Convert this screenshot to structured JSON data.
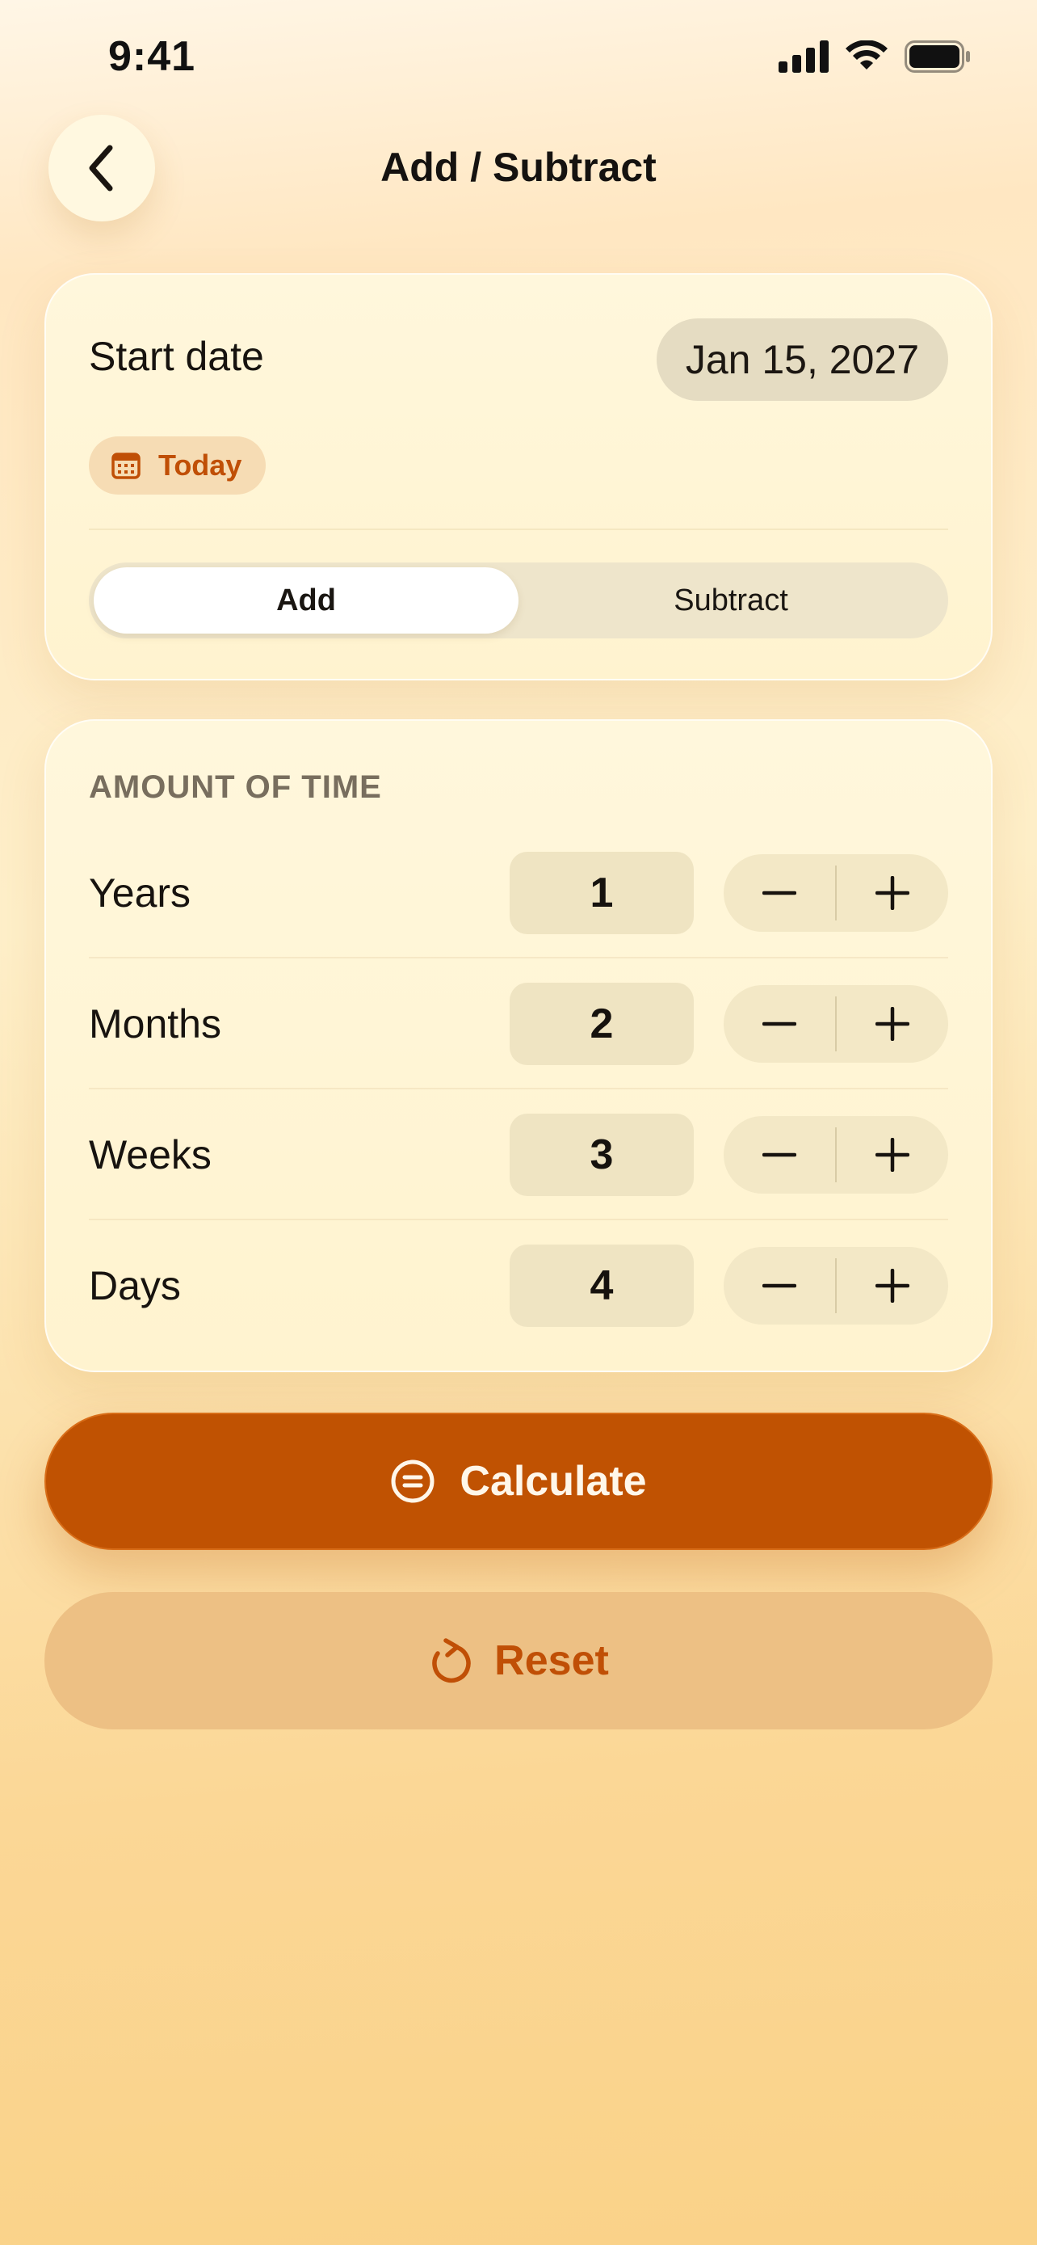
{
  "status_bar": {
    "time": "9:41"
  },
  "header": {
    "title": "Add / Subtract"
  },
  "start_card": {
    "label": "Start date",
    "date_value": "Jan 15, 2027",
    "today_label": "Today",
    "segments": [
      {
        "label": "Add",
        "active": true
      },
      {
        "label": "Subtract",
        "active": false
      }
    ]
  },
  "amount_card": {
    "header": "AMOUNT OF TIME",
    "rows": [
      {
        "label": "Years",
        "value": "1"
      },
      {
        "label": "Months",
        "value": "2"
      },
      {
        "label": "Weeks",
        "value": "3"
      },
      {
        "label": "Days",
        "value": "4"
      }
    ]
  },
  "actions": {
    "calculate_label": "Calculate",
    "reset_label": "Reset"
  },
  "colors": {
    "accent": "#c05202",
    "accent_text": "#c04f06",
    "reset_bg": "#edc084"
  },
  "icons": {
    "back": "chevron-left-icon",
    "today": "calendar-icon",
    "minus": "minus-icon",
    "plus": "plus-icon",
    "calculate": "equals-circle-icon",
    "reset": "refresh-icon"
  }
}
